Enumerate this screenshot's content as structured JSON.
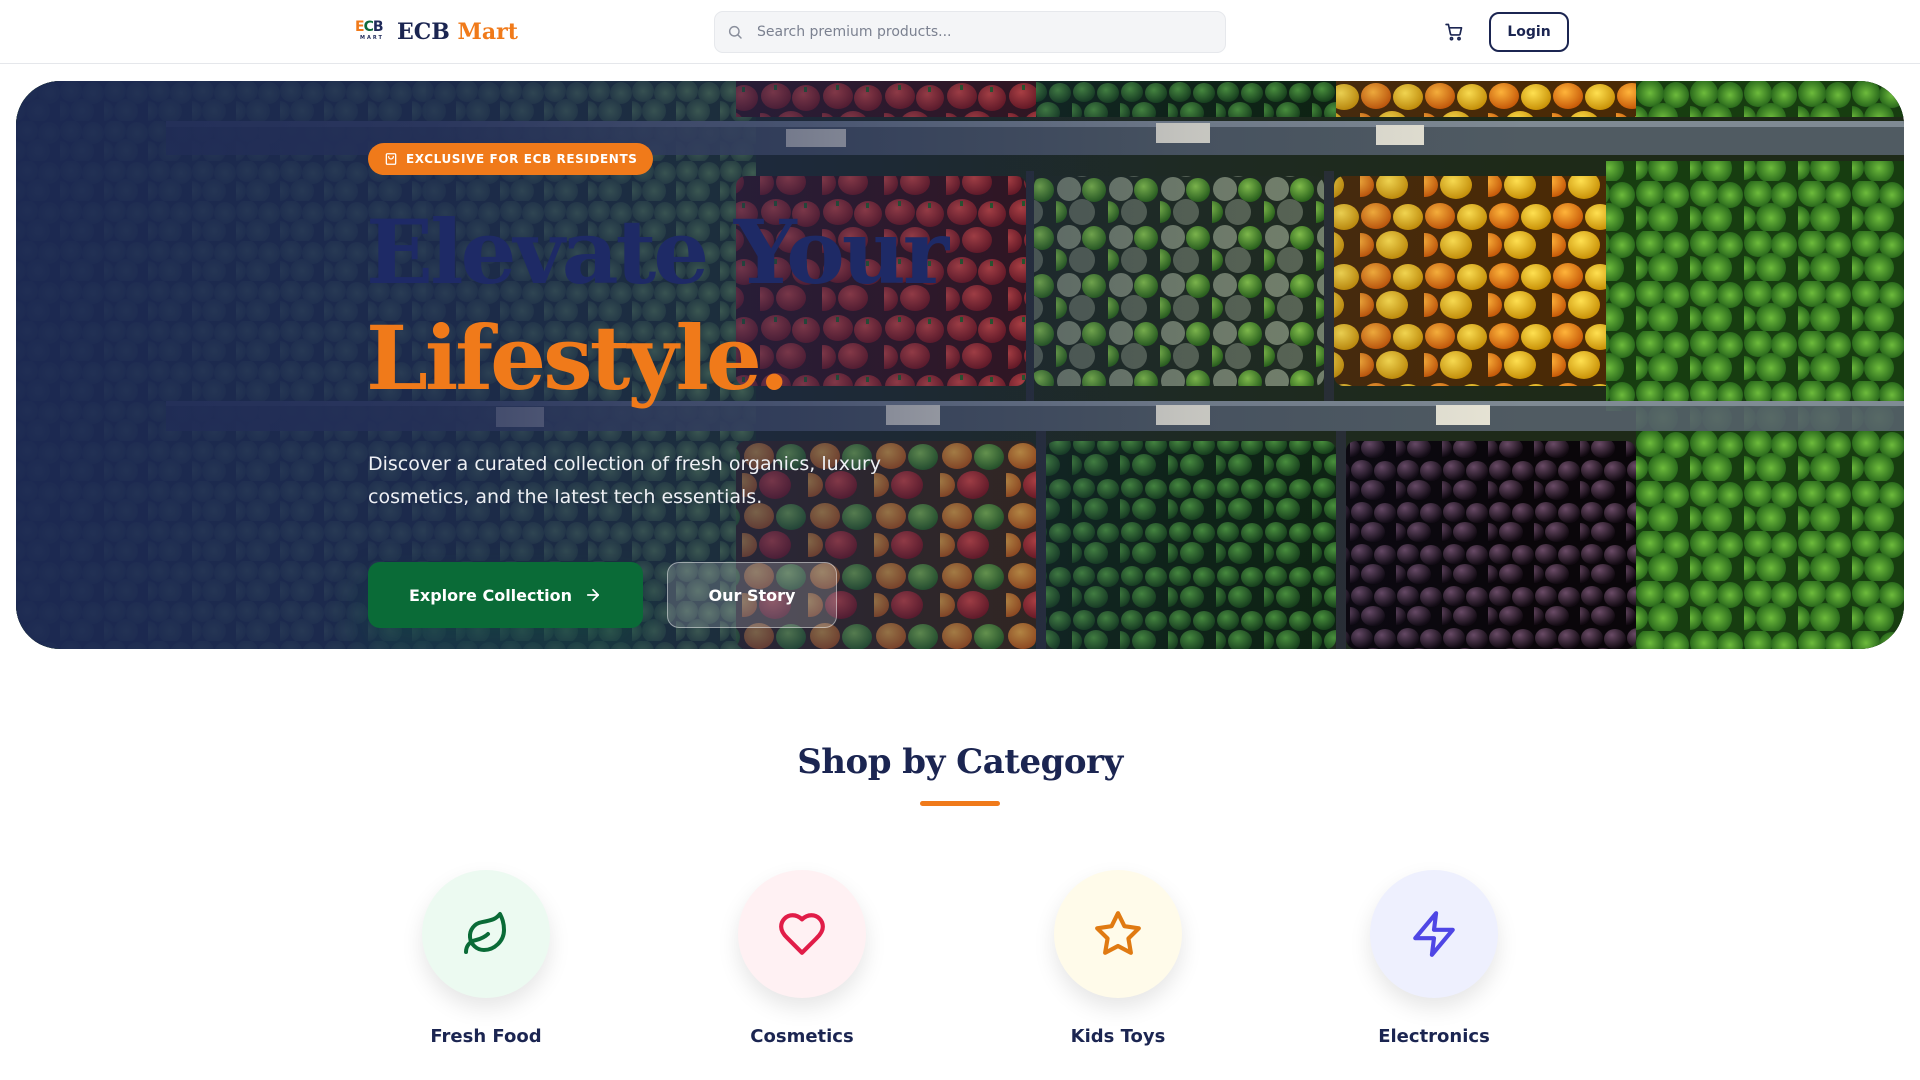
{
  "header": {
    "logo": {
      "mark_letters": [
        "E",
        "C",
        "B"
      ],
      "mark_sub": "MART",
      "name_primary": "ECB",
      "name_accent": "Mart"
    },
    "search": {
      "placeholder": "Search premium products...",
      "value": ""
    },
    "cart_icon": "shopping-cart-icon",
    "login_label": "Login"
  },
  "hero": {
    "badge": "EXCLUSIVE FOR ECB RESIDENTS",
    "title_line1": "Elevate Your",
    "title_line2": "Lifestyle.",
    "subtitle": "Discover a curated collection of fresh organics, luxury cosmetics, and the latest tech essentials.",
    "primary_button": "Explore Collection",
    "secondary_button": "Our Story",
    "background": "produce-shelf-photo"
  },
  "categories": {
    "title": "Shop by Category",
    "items": [
      {
        "label": "Fresh Food",
        "icon": "leaf-icon",
        "color": "#0a6b37",
        "bg": "#ecfaf1"
      },
      {
        "label": "Cosmetics",
        "icon": "heart-icon",
        "color": "#e11d48",
        "bg": "#fff1f3"
      },
      {
        "label": "Kids Toys",
        "icon": "star-icon",
        "color": "#e07a12",
        "bg": "#fffbea"
      },
      {
        "label": "Electronics",
        "icon": "lightning-icon",
        "color": "#4f46e5",
        "bg": "#eef0fe"
      }
    ]
  },
  "colors": {
    "brand_navy": "#1b2551",
    "brand_orange": "#f07a1a",
    "brand_green": "#0a6b37"
  }
}
